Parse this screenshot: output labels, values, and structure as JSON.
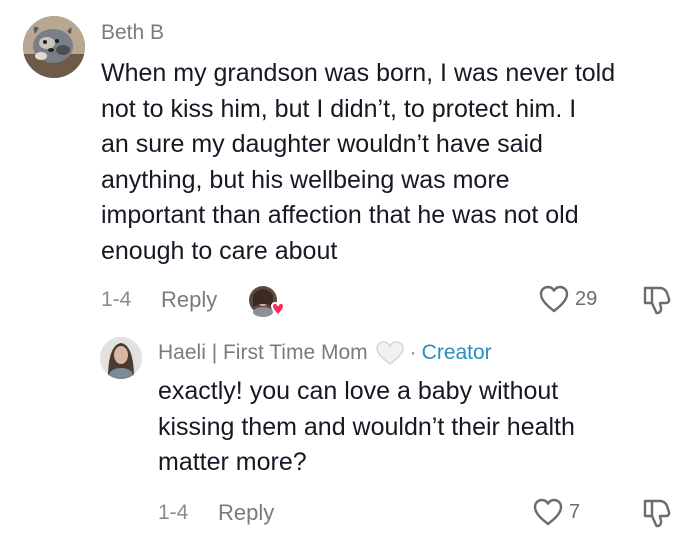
{
  "comment": {
    "username": "Beth B",
    "text_lines": [
      "When my grandson was born, I was never told",
      "not to kiss him, but I didn’t, to protect him. I",
      "an sure my daughter wouldn’t have said",
      "anything, but his wellbeing was more",
      "important than affection that he was not old",
      "enough to care about"
    ],
    "date": "1-4",
    "reply_label": "Reply",
    "likes": "29",
    "icons": {
      "like": "heart-outline-icon",
      "dislike": "thumbs-down-icon",
      "creator_liked": "creator-liked-avatar-heart"
    }
  },
  "reply": {
    "username": "Haeli | First Time Mom",
    "separator": "·",
    "badge": "Creator",
    "text_lines": [
      "exactly! you can love a baby without",
      "kissing them and wouldn’t their health",
      "matter more?"
    ],
    "date": "1-4",
    "reply_label": "Reply",
    "likes": "7",
    "colors": {
      "badge": "#2a8fc1",
      "liked_heart": "#fe2c55"
    }
  }
}
